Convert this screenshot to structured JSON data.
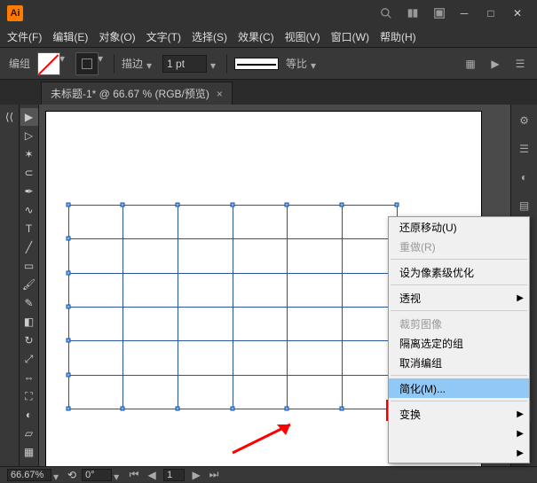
{
  "menubar": {
    "items": [
      "文件(F)",
      "编辑(E)",
      "对象(O)",
      "文字(T)",
      "选择(S)",
      "效果(C)",
      "视图(V)",
      "窗口(W)",
      "帮助(H)"
    ]
  },
  "controlbar": {
    "label": "编组",
    "stroke_label": "描边",
    "stroke_value": "1 pt",
    "ratio_label": "等比"
  },
  "tab": {
    "title": "未标题-1* @ 66.67 % (RGB/预览)",
    "close": "×"
  },
  "context_menu": {
    "items": [
      {
        "label": "还原移动(U)",
        "type": "item"
      },
      {
        "label": "重做(R)",
        "type": "disabled"
      },
      {
        "type": "sep"
      },
      {
        "label": "设为像素级优化",
        "type": "item"
      },
      {
        "type": "sep"
      },
      {
        "label": "透视",
        "type": "submenu"
      },
      {
        "type": "sep"
      },
      {
        "label": "裁剪图像",
        "type": "disabled"
      },
      {
        "label": "隔离选定的组",
        "type": "item"
      },
      {
        "label": "取消编组",
        "type": "item"
      },
      {
        "type": "sep"
      },
      {
        "label": "简化(M)...",
        "type": "highlight"
      },
      {
        "type": "sep"
      },
      {
        "label": "变换",
        "type": "submenu"
      }
    ]
  },
  "statusbar": {
    "zoom": "66.67%",
    "rotate": "0°",
    "page": "1"
  }
}
